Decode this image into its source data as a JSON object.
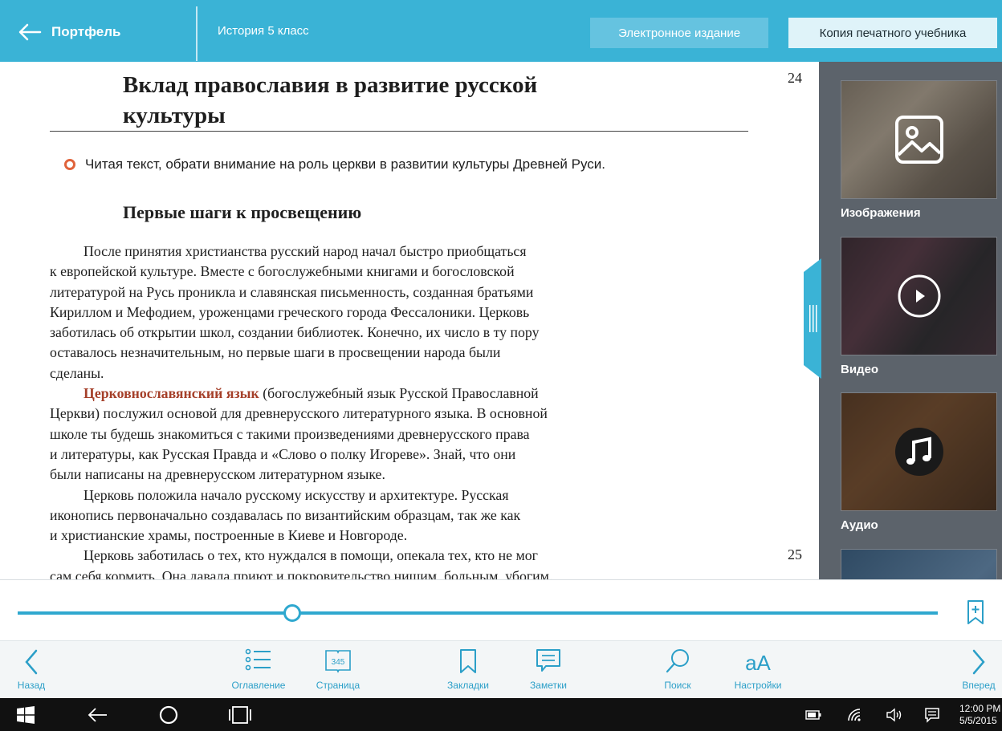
{
  "header": {
    "back_label": "Портфель",
    "book_title": "История 5 класс",
    "mode_electronic": "Электронное издание",
    "mode_print": "Копия печатного учебника"
  },
  "page": {
    "chapter_title_line1": "Вклад православия в развитие русской",
    "chapter_title_line2": "культуры",
    "page_number_top": "24",
    "page_number_bottom": "25",
    "task": "Читая текст, обрати внимание на роль церкви в развитии культуры Древней Руси.",
    "section_title": "Первые шаги к просвещению",
    "lines": [
      "После принятия христианства русский народ начал быстро приобщаться",
      "к европейской культуре. Вместе с богослужебными книгами и богословской",
      "литературой на Русь проникла и славянская письменность, созданная братьями",
      "Кириллом и Мефодием, уроженцами греческого города Фессалоники. Церковь",
      "заботилась об открытии школ, создании библиотек. Конечно, их число в ту пору",
      "оставалось незначительным, но первые шаги в просвещении народа были",
      "сделаны."
    ],
    "term": "Церковнославянский язык",
    "term_rest": " (богослужебный язык Русской Православной",
    "lines2": [
      "Церкви) послужил основой для древнерусского литературного языка. В основной",
      "школе ты будешь знакомиться с такими произведениями древнерусского права",
      "и литературы, как Русская Правда и «Слово о полку Игореве». Знай, что они",
      "были написаны на древнерусском литературном языке.",
      "Церковь положила начало русскому искусству и архитектуре. Русская",
      "иконопись первоначально создавалась по византийским образцам, так же как",
      "и христианские храмы, построенные в Киеве и Новгороде.",
      "Церковь заботилась о тех, кто нуждался в помощи, опекала тех, кто не мог",
      "сам себя кормить. Она давала приют и покровительство нищим, больным, убогим."
    ]
  },
  "sidebar": {
    "images_label": "Изображения",
    "video_label": "Видео",
    "audio_label": "Аудио"
  },
  "progress": {
    "fraction": 0.298
  },
  "toolbar": {
    "back": "Назад",
    "contents": "Оглавление",
    "page": "Страница",
    "page_icon_number": "345",
    "bookmarks": "Закладки",
    "notes": "Заметки",
    "search": "Поиск",
    "settings": "Настройки",
    "settings_glyph": "aA",
    "forward": "Вперед"
  },
  "taskbar": {
    "time": "12:00 PM",
    "date": "5/5/2015"
  },
  "colors": {
    "accent": "#3ab3d6",
    "sidebar": "#5c636b",
    "term": "#a5402a",
    "task_bullet": "#e0633b"
  }
}
